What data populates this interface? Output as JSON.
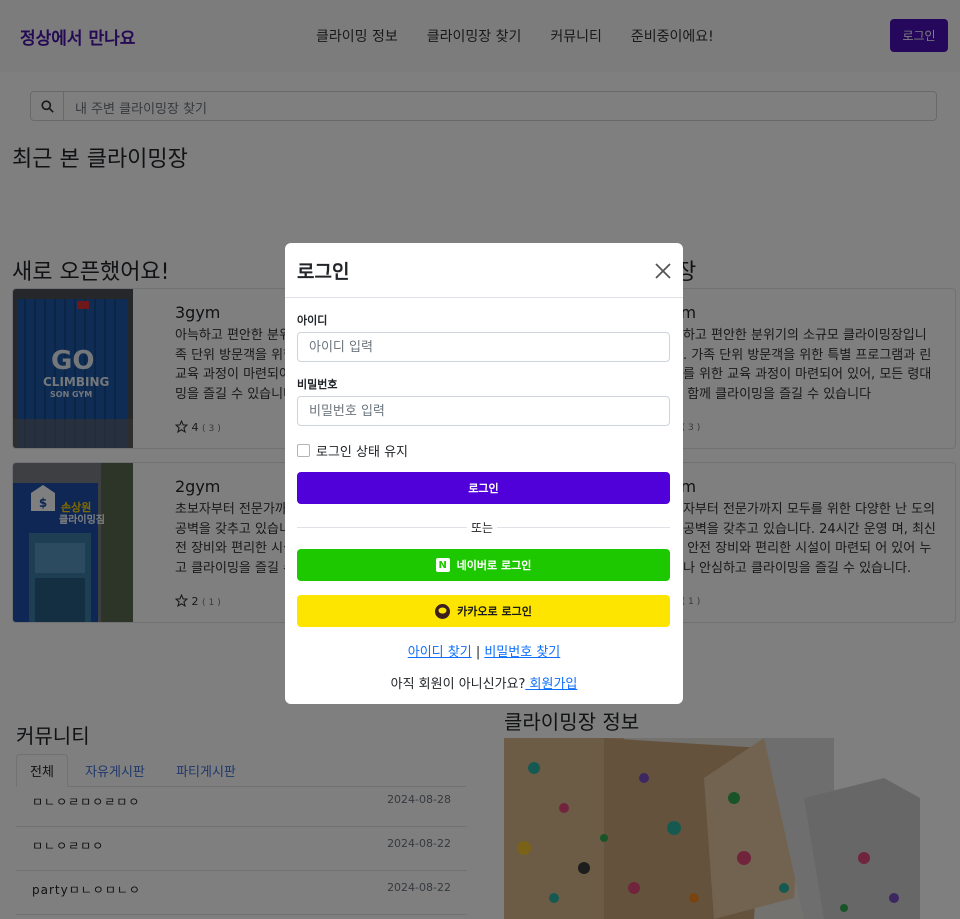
{
  "navbar": {
    "brand": "정상에서 만나요",
    "links": [
      "클라이밍 정보",
      "클라이밍장 찾기",
      "커뮤니티",
      "준비중이에요!"
    ],
    "login_label": "로그인"
  },
  "search": {
    "placeholder": "내 주변 클라이밍장 찾기",
    "icon": "search-icon"
  },
  "sections": {
    "recent": "최근 본 클라이밍장",
    "new_open": "새로 오픈했어요!",
    "right_title_suffix": "장",
    "community": "커뮤니티",
    "gym_info": "클라이밍장 정보"
  },
  "new_gyms": [
    {
      "name": "3gym",
      "desc": "아늑하고 편안한 분위기의 소규모 클라이밍장입니다. 가족 단위 방문객을 위한 특별 프로그램과 어린이를 위한 교육 과정이 마련되어 있어, 모든 연령대가 함께 클라이밍을 즐길 수 있습니다",
      "rating": "4",
      "count": "( 3 )"
    },
    {
      "name": "2gym",
      "desc": "초보자부터 전문가까지 모두를 위한 다양한 난이도의 인공벽을 갖추고 있습니다. 24시간 운영하며, 최신식 안전 장비와 편리한 시설이 마련되어 있어 누구나 안심하고 클라이밍을 즐길 수 있습니다.",
      "rating": "2",
      "count": "( 1 )"
    }
  ],
  "right_gyms": [
    {
      "name": "ym",
      "desc": "늑하고 편안한 분위기의 소규모 클라이밍장입니다. 가족 단위 방문객을 위한 특별 프로그램과 린이를 위한 교육 과정이 마련되어 있어, 모든 령대가 함께 클라이밍을 즐길 수 있습니다",
      "rating": "4",
      "count": "( 3 )"
    },
    {
      "name": "ym",
      "desc": "보자부터 전문가까지 모두를 위한 다양한 난 도의 인공벽을 갖추고 있습니다. 24시간 운영 며, 최신식 안전 장비와 편리한 시설이 마련되 어 있어 누구나 안심하고 클라이밍을 즐길 수 있습니다.",
      "rating": "2",
      "count": "( 1 )"
    }
  ],
  "thumb_text": {
    "go": "GO",
    "climbing": "CLIMBING",
    "son": "SON GYM",
    "sign1": "손상원",
    "sign2": "클라이밍짐"
  },
  "community": {
    "tabs": [
      "전체",
      "자유게시판",
      "파티게시판"
    ],
    "posts": [
      {
        "title": "ㅁㄴㅇㄹㅁㅇㄹㅁㅇ",
        "date": "2024-08-28"
      },
      {
        "title": "ㅁㄴㅇㄹㅁㅇ",
        "date": "2024-08-22"
      },
      {
        "title": "partyㅁㄴㅇㅁㄴㅇ",
        "date": "2024-08-22"
      }
    ]
  },
  "modal": {
    "title": "로그인",
    "id_label": "아이디",
    "id_placeholder": "아이디 입력",
    "pw_label": "비밀번호",
    "pw_placeholder": "비밀번호 입력",
    "remember_label": "로그인 상태 유지",
    "login_button": "로그인",
    "or_text": "또는",
    "naver_button": "네이버로 로그인",
    "naver_letter": "N",
    "kakao_button": "카카오로 로그인",
    "find_id": "아이디 찾기",
    "separator": "|",
    "find_pw": "비밀번호 찾기",
    "not_member": "아직 회원이 아니신가요?",
    "signup": " 회원가입"
  },
  "colors": {
    "brand": "#4b12a8",
    "primary": "#5000d9",
    "naver": "#1ec800",
    "kakao": "#fee500",
    "link": "#0d6efd"
  }
}
